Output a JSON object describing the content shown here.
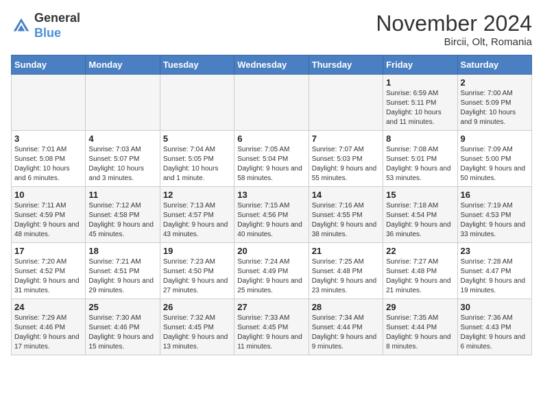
{
  "logo": {
    "general": "General",
    "blue": "Blue"
  },
  "title": "November 2024",
  "subtitle": "Bircii, Olt, Romania",
  "weekdays": [
    "Sunday",
    "Monday",
    "Tuesday",
    "Wednesday",
    "Thursday",
    "Friday",
    "Saturday"
  ],
  "weeks": [
    [
      {
        "day": "",
        "info": ""
      },
      {
        "day": "",
        "info": ""
      },
      {
        "day": "",
        "info": ""
      },
      {
        "day": "",
        "info": ""
      },
      {
        "day": "",
        "info": ""
      },
      {
        "day": "1",
        "info": "Sunrise: 6:59 AM\nSunset: 5:11 PM\nDaylight: 10 hours and 11 minutes."
      },
      {
        "day": "2",
        "info": "Sunrise: 7:00 AM\nSunset: 5:09 PM\nDaylight: 10 hours and 9 minutes."
      }
    ],
    [
      {
        "day": "3",
        "info": "Sunrise: 7:01 AM\nSunset: 5:08 PM\nDaylight: 10 hours and 6 minutes."
      },
      {
        "day": "4",
        "info": "Sunrise: 7:03 AM\nSunset: 5:07 PM\nDaylight: 10 hours and 3 minutes."
      },
      {
        "day": "5",
        "info": "Sunrise: 7:04 AM\nSunset: 5:05 PM\nDaylight: 10 hours and 1 minute."
      },
      {
        "day": "6",
        "info": "Sunrise: 7:05 AM\nSunset: 5:04 PM\nDaylight: 9 hours and 58 minutes."
      },
      {
        "day": "7",
        "info": "Sunrise: 7:07 AM\nSunset: 5:03 PM\nDaylight: 9 hours and 55 minutes."
      },
      {
        "day": "8",
        "info": "Sunrise: 7:08 AM\nSunset: 5:01 PM\nDaylight: 9 hours and 53 minutes."
      },
      {
        "day": "9",
        "info": "Sunrise: 7:09 AM\nSunset: 5:00 PM\nDaylight: 9 hours and 50 minutes."
      }
    ],
    [
      {
        "day": "10",
        "info": "Sunrise: 7:11 AM\nSunset: 4:59 PM\nDaylight: 9 hours and 48 minutes."
      },
      {
        "day": "11",
        "info": "Sunrise: 7:12 AM\nSunset: 4:58 PM\nDaylight: 9 hours and 45 minutes."
      },
      {
        "day": "12",
        "info": "Sunrise: 7:13 AM\nSunset: 4:57 PM\nDaylight: 9 hours and 43 minutes."
      },
      {
        "day": "13",
        "info": "Sunrise: 7:15 AM\nSunset: 4:56 PM\nDaylight: 9 hours and 40 minutes."
      },
      {
        "day": "14",
        "info": "Sunrise: 7:16 AM\nSunset: 4:55 PM\nDaylight: 9 hours and 38 minutes."
      },
      {
        "day": "15",
        "info": "Sunrise: 7:18 AM\nSunset: 4:54 PM\nDaylight: 9 hours and 36 minutes."
      },
      {
        "day": "16",
        "info": "Sunrise: 7:19 AM\nSunset: 4:53 PM\nDaylight: 9 hours and 33 minutes."
      }
    ],
    [
      {
        "day": "17",
        "info": "Sunrise: 7:20 AM\nSunset: 4:52 PM\nDaylight: 9 hours and 31 minutes."
      },
      {
        "day": "18",
        "info": "Sunrise: 7:21 AM\nSunset: 4:51 PM\nDaylight: 9 hours and 29 minutes."
      },
      {
        "day": "19",
        "info": "Sunrise: 7:23 AM\nSunset: 4:50 PM\nDaylight: 9 hours and 27 minutes."
      },
      {
        "day": "20",
        "info": "Sunrise: 7:24 AM\nSunset: 4:49 PM\nDaylight: 9 hours and 25 minutes."
      },
      {
        "day": "21",
        "info": "Sunrise: 7:25 AM\nSunset: 4:48 PM\nDaylight: 9 hours and 23 minutes."
      },
      {
        "day": "22",
        "info": "Sunrise: 7:27 AM\nSunset: 4:48 PM\nDaylight: 9 hours and 21 minutes."
      },
      {
        "day": "23",
        "info": "Sunrise: 7:28 AM\nSunset: 4:47 PM\nDaylight: 9 hours and 19 minutes."
      }
    ],
    [
      {
        "day": "24",
        "info": "Sunrise: 7:29 AM\nSunset: 4:46 PM\nDaylight: 9 hours and 17 minutes."
      },
      {
        "day": "25",
        "info": "Sunrise: 7:30 AM\nSunset: 4:46 PM\nDaylight: 9 hours and 15 minutes."
      },
      {
        "day": "26",
        "info": "Sunrise: 7:32 AM\nSunset: 4:45 PM\nDaylight: 9 hours and 13 minutes."
      },
      {
        "day": "27",
        "info": "Sunrise: 7:33 AM\nSunset: 4:45 PM\nDaylight: 9 hours and 11 minutes."
      },
      {
        "day": "28",
        "info": "Sunrise: 7:34 AM\nSunset: 4:44 PM\nDaylight: 9 hours and 9 minutes."
      },
      {
        "day": "29",
        "info": "Sunrise: 7:35 AM\nSunset: 4:44 PM\nDaylight: 9 hours and 8 minutes."
      },
      {
        "day": "30",
        "info": "Sunrise: 7:36 AM\nSunset: 4:43 PM\nDaylight: 9 hours and 6 minutes."
      }
    ]
  ]
}
